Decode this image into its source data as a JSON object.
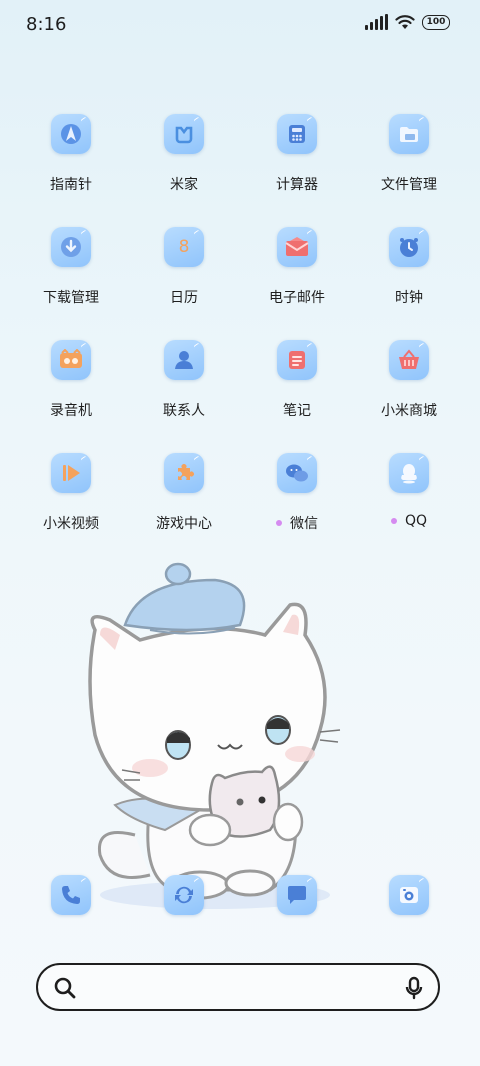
{
  "status_bar": {
    "time": "8:16",
    "battery": "100"
  },
  "apps": [
    {
      "label": "指南针",
      "icon": "compass-icon"
    },
    {
      "label": "米家",
      "icon": "mijia-icon"
    },
    {
      "label": "计算器",
      "icon": "calculator-icon"
    },
    {
      "label": "文件管理",
      "icon": "folder-icon"
    },
    {
      "label": "下载管理",
      "icon": "download-icon"
    },
    {
      "label": "日历",
      "icon": "calendar-icon",
      "glyph": "8"
    },
    {
      "label": "电子邮件",
      "icon": "mail-icon"
    },
    {
      "label": "时钟",
      "icon": "clock-icon"
    },
    {
      "label": "录音机",
      "icon": "recorder-icon"
    },
    {
      "label": "联系人",
      "icon": "contacts-icon"
    },
    {
      "label": "笔记",
      "icon": "notes-icon"
    },
    {
      "label": "小米商城",
      "icon": "shop-basket-icon"
    },
    {
      "label": "小米视频",
      "icon": "video-play-icon"
    },
    {
      "label": "游戏中心",
      "icon": "game-puzzle-icon"
    },
    {
      "label": "微信",
      "icon": "wechat-icon",
      "new": true
    },
    {
      "label": "QQ",
      "icon": "qq-penguin-icon",
      "new": true
    }
  ],
  "dock": [
    {
      "icon": "phone-icon"
    },
    {
      "icon": "browser-icon"
    },
    {
      "icon": "messages-icon"
    },
    {
      "icon": "camera-icon"
    }
  ],
  "colors": {
    "icon_bg": "#a9d2fd",
    "new_dot": "#d58bf0",
    "accent_orange": "#f4a25d",
    "accent_red": "#ef6f6f",
    "accent_blue": "#4a8fe0"
  }
}
